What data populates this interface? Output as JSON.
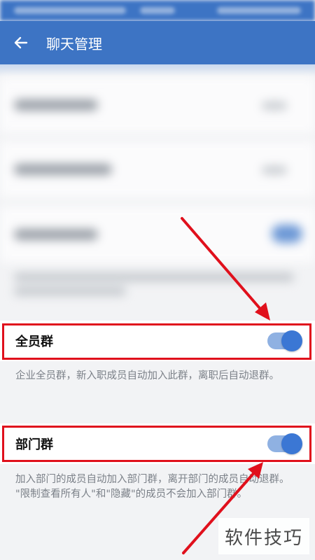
{
  "header": {
    "title": "聊天管理",
    "back_icon": "arrow-left-icon"
  },
  "settings": [
    {
      "label": "全员群",
      "enabled": true,
      "description": "企业全员群，新入职成员自动加入此群，离职后自动退群。"
    },
    {
      "label": "部门群",
      "enabled": true,
      "description_lines": [
        "加入部门的成员自动加入部门群，离开部门的成员自动退群。",
        "\"限制查看所有人\"和\"隐藏\"的成员不会加入部门群。"
      ]
    }
  ],
  "watermark": "软件技巧",
  "colors": {
    "appbar": "#3d74c4",
    "toggle_on": "#3b77d4",
    "annotation": "#e0101c"
  }
}
